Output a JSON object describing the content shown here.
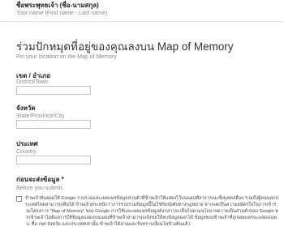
{
  "name_field": {
    "label": "ชื่อพระพุทธเจ้า (ชื่อ-นามสกุล)",
    "sublabel": "Your name (First name - Last name)"
  },
  "section": {
    "title": "ร่วมปักหมุดที่อยู่ของคุณลงบน Map of Memory",
    "subtitle": "Pin your location on the Map of Memory"
  },
  "district_field": {
    "label": "เขต / อำเภอ",
    "sublabel": "District/Town"
  },
  "province_field": {
    "label": "จังหวัด",
    "sublabel": "State/Province/City"
  },
  "country_field": {
    "label": "ประเทศ",
    "sublabel": "Country"
  },
  "consent": {
    "label": "ก่อนจะส่งข้อมูล *",
    "sublabel": "Before you submit.",
    "text": "ข้าพเจ้ายินยอมให้ Google รวบรวมและเผยแพร่ข้อมูลส่วนตัวที่ข้าพเจ้าให้แสดงไว้บนแผนที่สาธารณะซึ่งบุคคลอื่นๆ รวมถึงผู้คนนอกประเทศไทยสามารถเห็นได้ ข้าพเจ้าตระหนักว่าการรวบรวมข้อมูลนี้ไม่ใช่ข้อบังคับทางกฎหมาย หากแต่เป็นความสมัครใจในการเข้าร่วมโครงการ \"Map of Memory\" ของ Google การใช้และเผยแพร่ข้อมูลดังกล่าวจะเป็นไปตามนโยบายความเป็นส่วนตัวของ Google หากข้าพเจ้าไม่ต้องการให้ข้อมูลแสดงบนแผนที่ข้าพเจ้าสามารถแจ้งขอให้ลบข้อมูลออกได้ ข้อมูลของข้าพเจ้าที่ถูกเผยแพร่จะแสดงเฉพาะ ชื่อ เขต จังหวัด และประเทศเท่านั้น ข้าพเจ้าได้อ่านและรับทราบเงื่อนไขข้างต้นแล้ว"
  }
}
